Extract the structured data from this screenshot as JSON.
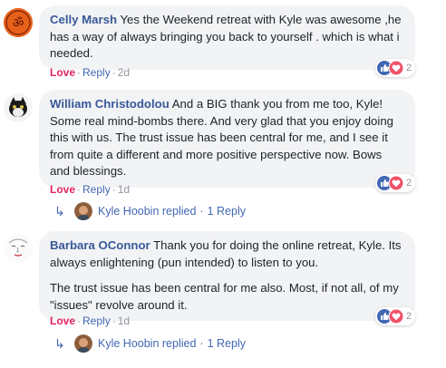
{
  "colors": {
    "author": "#385898",
    "love": "#e0245e",
    "link": "#4267b2",
    "meta": "#90949c",
    "bubble": "#f2f3f5"
  },
  "comments": [
    {
      "author": "Celly Marsh",
      "paragraphs": [
        "Yes the Weekend retreat with Kyle was awesome ,he has a way of always bringing you back to yourself . which is what i needed."
      ],
      "avatar_icon": "om-symbol-icon",
      "reaction": "Love",
      "reply": "Reply",
      "time": "2d",
      "reaction_count": "2",
      "reaction_icons": [
        "like-icon",
        "love-icon"
      ]
    },
    {
      "author": "William Christodolou",
      "paragraphs": [
        "And a BIG thank you from me too, Kyle! Some real mind-bombs there. And very glad that you enjoy doing this with us. The trust issue has been central for me, and I see it from quite a different and more positive perspective now. Bows and blessings."
      ],
      "avatar_icon": "cat-avatar-icon",
      "reaction": "Love",
      "reply": "Reply",
      "time": "1d",
      "reaction_count": "2",
      "reaction_icons": [
        "like-icon",
        "love-icon"
      ],
      "replied": {
        "name": "Kyle Hoobin",
        "text": "replied",
        "count": "1 Reply"
      }
    },
    {
      "author": "Barbara OConnor",
      "paragraphs": [
        "Thank you for doing the online retreat, Kyle. Its always enlightening (pun intended) to listen to you.",
        "The trust issue has been central for me also. Most, if not all, of my \"issues\" revolve around it."
      ],
      "avatar_icon": "sketch-avatar-icon",
      "reaction": "Love",
      "reply": "Reply",
      "time": "1d",
      "reaction_count": "2",
      "reaction_icons": [
        "like-icon",
        "love-icon"
      ],
      "replied": {
        "name": "Kyle Hoobin",
        "text": "replied",
        "count": "1 Reply"
      }
    }
  ]
}
